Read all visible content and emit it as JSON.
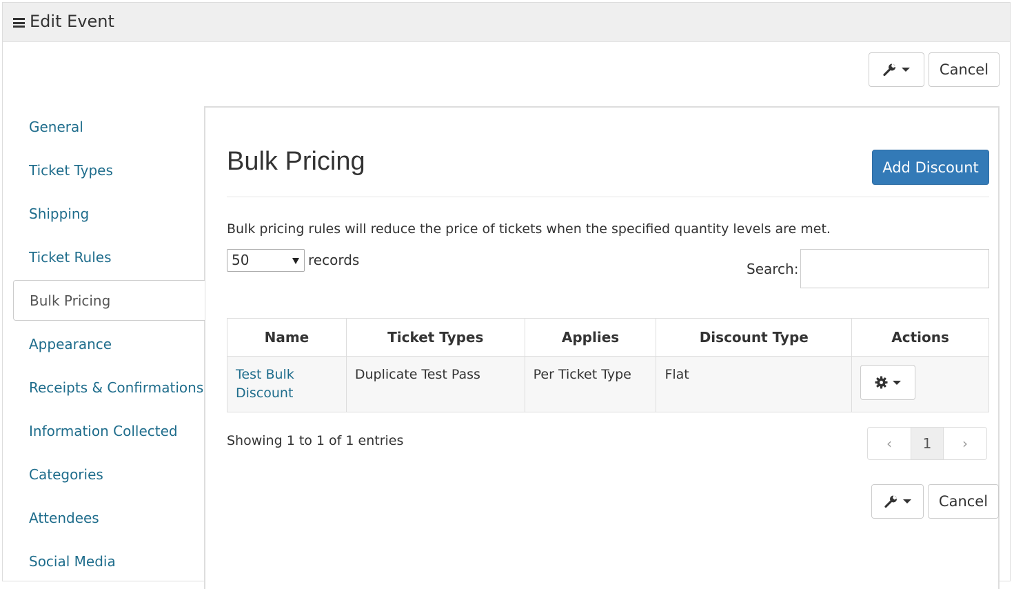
{
  "window": {
    "title": "Edit Event"
  },
  "toolbar": {
    "cancel_label": "Cancel",
    "tools_icon": "wrench-icon"
  },
  "sidebar": {
    "items": [
      {
        "label": "General"
      },
      {
        "label": "Ticket Types"
      },
      {
        "label": "Shipping"
      },
      {
        "label": "Ticket Rules"
      },
      {
        "label": "Bulk Pricing",
        "active": true
      },
      {
        "label": "Appearance"
      },
      {
        "label": "Receipts & Confirmations"
      },
      {
        "label": "Information Collected"
      },
      {
        "label": "Categories"
      },
      {
        "label": "Attendees"
      },
      {
        "label": "Social Media"
      }
    ]
  },
  "main": {
    "heading": "Bulk Pricing",
    "add_button": "Add Discount",
    "description": "Bulk pricing rules will reduce the price of tickets when the specified quantity levels are met.",
    "records": {
      "selected": "50",
      "label": "records"
    },
    "search": {
      "label": "Search:",
      "value": ""
    },
    "table": {
      "columns": [
        "Name",
        "Ticket Types",
        "Applies",
        "Discount Type",
        "Actions"
      ],
      "rows": [
        {
          "name": "Test Bulk Discount",
          "ticket_types": "Duplicate Test Pass",
          "applies": "Per Ticket Type",
          "discount_type": "Flat"
        }
      ]
    },
    "showing": "Showing 1 to 1 of 1 entries",
    "pagination": {
      "prev": "‹",
      "current": "1",
      "next": "›"
    }
  },
  "colors": {
    "link": "#1f6d8c",
    "primary_button": "#337ab7",
    "titlebar": "#efefef"
  }
}
